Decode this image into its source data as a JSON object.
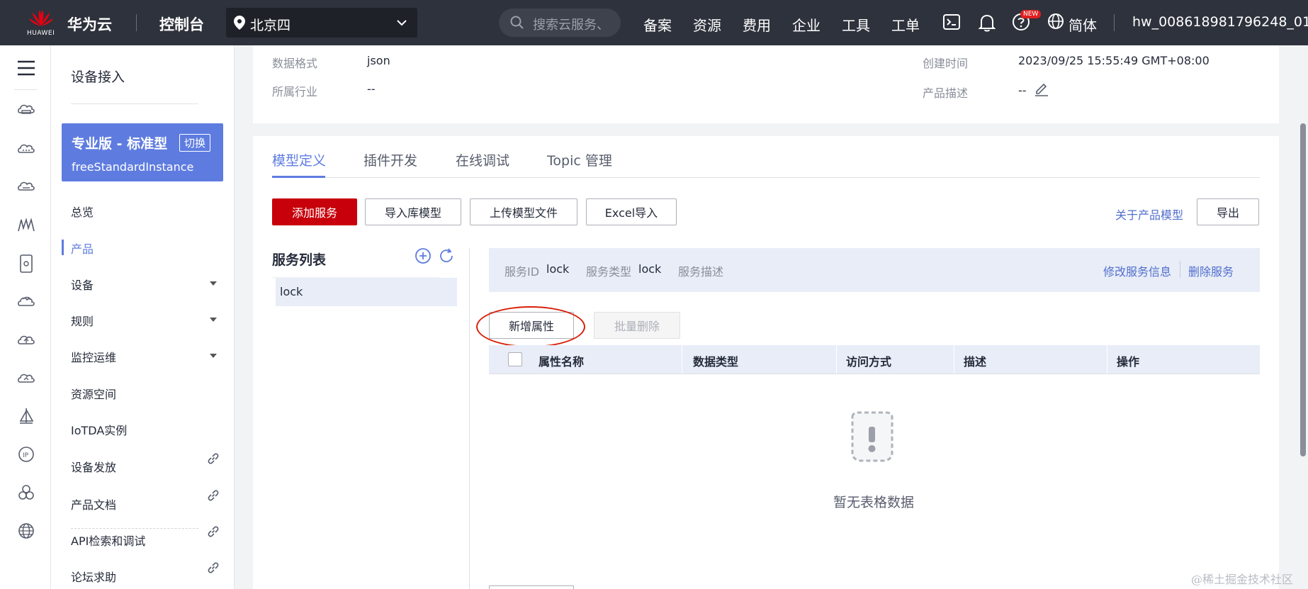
{
  "topbar": {
    "logo_text": "HUAWEI",
    "brand": "华为云",
    "console": "控制台",
    "region": "北京四",
    "search_placeholder": "搜索云服务、",
    "nav": [
      "备案",
      "资源",
      "费用",
      "企业",
      "工具",
      "工单"
    ],
    "new_badge": "NEW",
    "lang": "简体",
    "user": "hw_008618981796248_01"
  },
  "sidebar": {
    "title": "设备接入",
    "instance_title": "专业版 - 标准型",
    "instance_switch": "切换",
    "instance_name": "freeStandardInstance",
    "items": [
      "总览",
      "产品",
      "设备",
      "规则",
      "监控运维",
      "资源空间",
      "IoTDA实例",
      "设备发放",
      "产品文档",
      "API检索和调试",
      "论坛求助"
    ]
  },
  "info": {
    "data_format_label": "数据格式",
    "data_format_value": "json",
    "industry_label": "所属行业",
    "industry_value": "--",
    "created_label": "创建时间",
    "created_value": "2023/09/25 15:55:49 GMT+08:00",
    "desc_label": "产品描述",
    "desc_value": "--"
  },
  "tabs": [
    "模型定义",
    "插件开发",
    "在线调试",
    "Topic 管理"
  ],
  "toolbar": {
    "add_service": "添加服务",
    "import_library": "导入库模型",
    "upload_model": "上传模型文件",
    "excel_import": "Excel导入",
    "about_model": "关于产品模型",
    "export": "导出"
  },
  "service_list": {
    "title": "服务列表",
    "items": [
      "lock"
    ]
  },
  "service_info": {
    "id_label": "服务ID",
    "id_value": "lock",
    "type_label": "服务类型",
    "type_value": "lock",
    "desc_label": "服务描述",
    "edit": "修改服务信息",
    "delete": "删除服务"
  },
  "properties": {
    "add": "新增属性",
    "batch_delete": "批量删除",
    "columns": [
      "属性名称",
      "数据类型",
      "访问方式",
      "描述",
      "操作"
    ],
    "empty": "暂无表格数据"
  },
  "watermark": "@稀土掘金技术社区",
  "colors": {
    "topbar": "#2e323c",
    "accent": "#5e7ce0",
    "primary_button": "#c7000b"
  }
}
